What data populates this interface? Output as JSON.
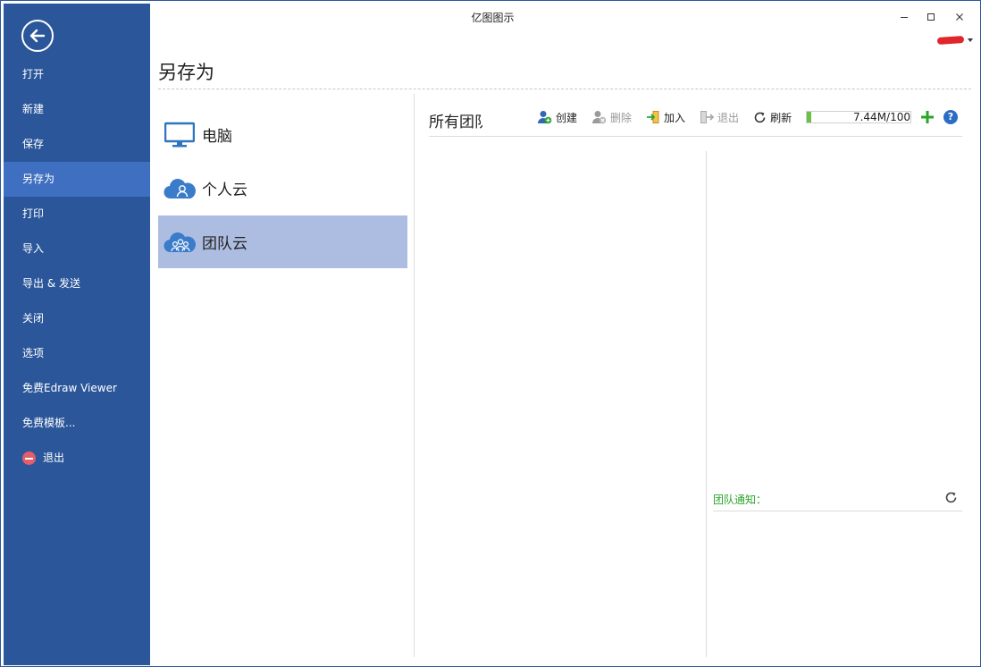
{
  "window": {
    "title": "亿图图示"
  },
  "sidebar": {
    "items": [
      {
        "label": "打开"
      },
      {
        "label": "新建"
      },
      {
        "label": "保存"
      },
      {
        "label": "另存为",
        "active": true
      },
      {
        "label": "打印"
      },
      {
        "label": "导入"
      },
      {
        "label": "导出 & 发送"
      },
      {
        "label": "关闭"
      },
      {
        "label": "选项"
      },
      {
        "label": "免费Edraw Viewer"
      },
      {
        "label": "免费模板..."
      },
      {
        "label": "退出",
        "icon": "exit-icon"
      }
    ]
  },
  "page": {
    "title": "另存为"
  },
  "locations": [
    {
      "label": "电脑",
      "icon": "monitor-icon"
    },
    {
      "label": "个人云",
      "icon": "cloud-user-icon"
    },
    {
      "label": "团队云",
      "icon": "cloud-team-icon",
      "selected": true
    }
  ],
  "team_panel": {
    "title": "所有团队",
    "toolbar": {
      "create": "创建",
      "delete": "删除",
      "join": "加入",
      "leave": "退出",
      "refresh": "刷新"
    },
    "storage": {
      "text": "7.44M/100",
      "used_fraction": 0.04
    },
    "notice_label": "团队通知："
  },
  "colors": {
    "sidebar_bg": "#2b579a",
    "sidebar_active": "#3f6fc1",
    "selected_location": "#adbde1",
    "notice_text": "#2aa52a",
    "storage_fill": "#6bc144"
  }
}
